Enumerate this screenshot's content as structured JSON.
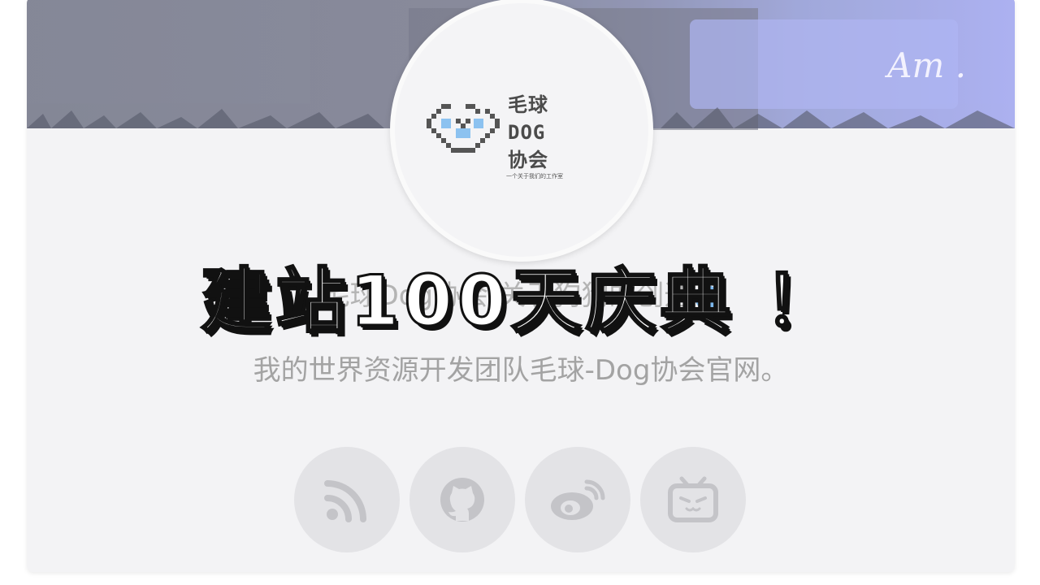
{
  "banner": {
    "signature": "Am ."
  },
  "logo": {
    "text_lines": [
      "毛球",
      "DOG",
      "协会"
    ],
    "tagline": "一个关于我们的工作室"
  },
  "profile": {
    "title": "毛球Dog协会-关于狗狗的创造",
    "description": "我的世界资源开发团队毛球-Dog协会官网。"
  },
  "overlay": {
    "headline": "建站100天庆典 ！"
  },
  "social_links": [
    {
      "icon": "rss-icon"
    },
    {
      "icon": "github-icon"
    },
    {
      "icon": "weibo-icon"
    },
    {
      "icon": "bilibili-icon"
    }
  ],
  "colors": {
    "card_background": "#f3f3f5",
    "social_button": "#e3e3e6",
    "social_icon": "#c4c4c8",
    "badge": "#7cb7ec",
    "logo_accent": "#8cc2f0"
  }
}
